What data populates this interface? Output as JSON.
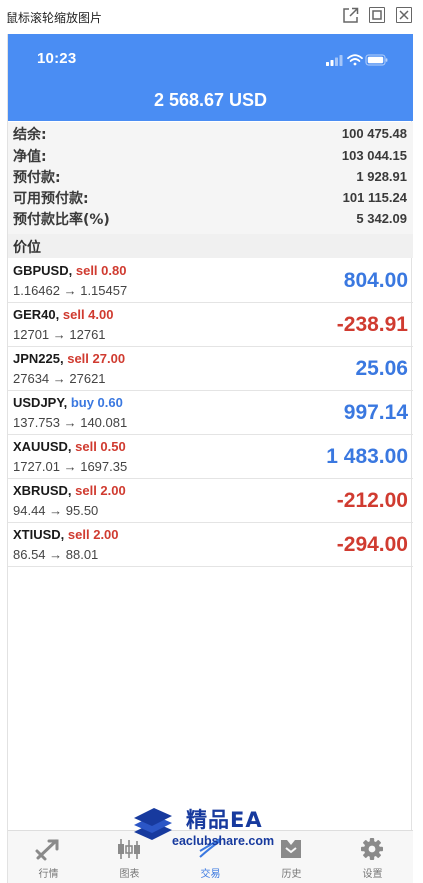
{
  "viewer": {
    "title": "鼠标滚轮缩放图片"
  },
  "status_bar": {
    "time": "10:23"
  },
  "header": {
    "balance": "2 568.67 USD"
  },
  "summary": [
    {
      "label": "结余:",
      "value": "100 475.48"
    },
    {
      "label": "净值:",
      "value": "103 044.15"
    },
    {
      "label": "预付款:",
      "value": "1 928.91"
    },
    {
      "label": "可用预付款:",
      "value": "101 115.24"
    },
    {
      "label": "预付款比率(%)",
      "value": "5 342.09"
    }
  ],
  "section_title": "价位",
  "positions": [
    {
      "symbol": "GBPUSD,",
      "side": "sell 0.80",
      "side_type": "sell",
      "prices": "1.16462 → 1.15457",
      "profit": "804.00",
      "profit_sign": "positive"
    },
    {
      "symbol": "GER40,",
      "side": "sell 4.00",
      "side_type": "sell",
      "prices": "12701 → 12761",
      "profit": "-238.91",
      "profit_sign": "negative"
    },
    {
      "symbol": "JPN225,",
      "side": "sell 27.00",
      "side_type": "sell",
      "prices": "27634 → 27621",
      "profit": "25.06",
      "profit_sign": "positive"
    },
    {
      "symbol": "USDJPY,",
      "side": "buy 0.60",
      "side_type": "buy",
      "prices": "137.753 → 140.081",
      "profit": "997.14",
      "profit_sign": "positive"
    },
    {
      "symbol": "XAUUSD,",
      "side": "sell 0.50",
      "side_type": "sell",
      "prices": "1727.01 → 1697.35",
      "profit": "1 483.00",
      "profit_sign": "positive"
    },
    {
      "symbol": "XBRUSD,",
      "side": "sell 2.00",
      "side_type": "sell",
      "prices": "94.44 → 95.50",
      "profit": "-212.00",
      "profit_sign": "negative"
    },
    {
      "symbol": "XTIUSD,",
      "side": "sell 2.00",
      "side_type": "sell",
      "prices": "86.54 → 88.01",
      "profit": "-294.00",
      "profit_sign": "negative"
    }
  ],
  "watermark": {
    "title": "精品EA",
    "subtitle": "eaclubshare.com"
  },
  "tabs": [
    {
      "label": "行情",
      "icon": "quotes-icon",
      "active": false
    },
    {
      "label": "图表",
      "icon": "chart-icon",
      "active": false
    },
    {
      "label": "交易",
      "icon": "trade-icon",
      "active": true
    },
    {
      "label": "历史",
      "icon": "history-icon",
      "active": false
    },
    {
      "label": "设置",
      "icon": "settings-icon",
      "active": false
    }
  ],
  "colors": {
    "header": "#4a8df3",
    "sell": "#d03b30",
    "buy": "#3a78e0",
    "profit_positive": "#3a78e0",
    "profit_negative": "#d03b30",
    "watermark": "#173a9e"
  }
}
